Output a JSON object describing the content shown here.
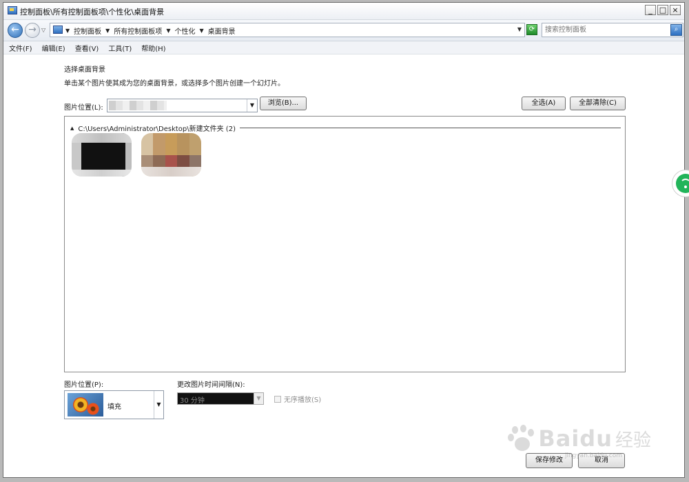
{
  "window": {
    "title": "控制面板\\所有控制面板项\\个性化\\桌面背景",
    "controls": {
      "minimize": "_",
      "maximize": "□",
      "close": "×"
    }
  },
  "address": {
    "crumbs": [
      "控制面板",
      "所有控制面板项",
      "个性化",
      "桌面背景"
    ],
    "search_placeholder": "搜索控制面板"
  },
  "menu": [
    "文件(F)",
    "编辑(E)",
    "查看(V)",
    "工具(T)",
    "帮助(H)"
  ],
  "content": {
    "title": "选择桌面背景",
    "description": "单击某个图片使其成为您的桌面背景，或选择多个图片创建一个幻灯片。",
    "location_label": "图片位置(L):",
    "browse_button": "浏览(B)...",
    "select_all_button": "全选(A)",
    "clear_all_button": "全部清除(C)",
    "group_header": "C:\\Users\\Administrator\\Desktop\\新建文件夹 (2)"
  },
  "bottom": {
    "position_label": "图片位置(P):",
    "position_value": "填充",
    "interval_label": "更改图片时间间隔(N):",
    "interval_value": "30 分钟",
    "shuffle_label": "无序播放(S)",
    "save_button": "保存修改",
    "cancel_button": "取消"
  },
  "watermark": {
    "brand": "Baidu",
    "product": "经验",
    "url": "jingyan.baidu.com"
  },
  "colors": {
    "accent": "#2d6fc0",
    "widget_green": "#22b45a"
  }
}
